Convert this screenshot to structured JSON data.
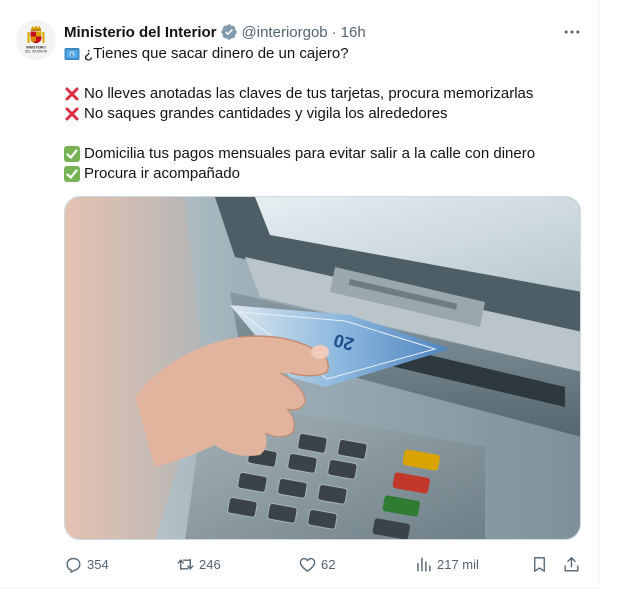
{
  "tweet": {
    "author": {
      "display_name": "Ministerio del Interior",
      "handle": "@interiorgob",
      "separator": "·",
      "time": "16h",
      "verified": true,
      "avatar_text": "MINISTERIO DEL INTERIOR"
    },
    "text_lines": [
      {
        "icon": "banknote-emoji-icon",
        "text": "¿Tienes que sacar dinero de un cajero?"
      },
      {
        "icon": "",
        "text": ""
      },
      {
        "icon": "red-cross-icon",
        "text": "No lleves anotadas las claves de tus tarjetas, procura memorizarlas"
      },
      {
        "icon": "red-cross-icon",
        "text": "No saques grandes cantidades y vigila los alrededores"
      },
      {
        "icon": "",
        "text": ""
      },
      {
        "icon": "green-check-icon",
        "text": "Domicilia tus pagos mensuales para evitar salir a la calle con dinero"
      },
      {
        "icon": "green-check-icon",
        "text": "Procura ir acompañado"
      }
    ],
    "media": {
      "description_icon": "atm-photo",
      "banknote_denomination": "20"
    },
    "actions": {
      "replies": "354",
      "retweets": "246",
      "likes": "62",
      "views": "217 mil"
    },
    "colors": {
      "verified": "#829aab",
      "cross": "#dd2e44",
      "check": "#77b255",
      "muted": "#536471"
    }
  }
}
